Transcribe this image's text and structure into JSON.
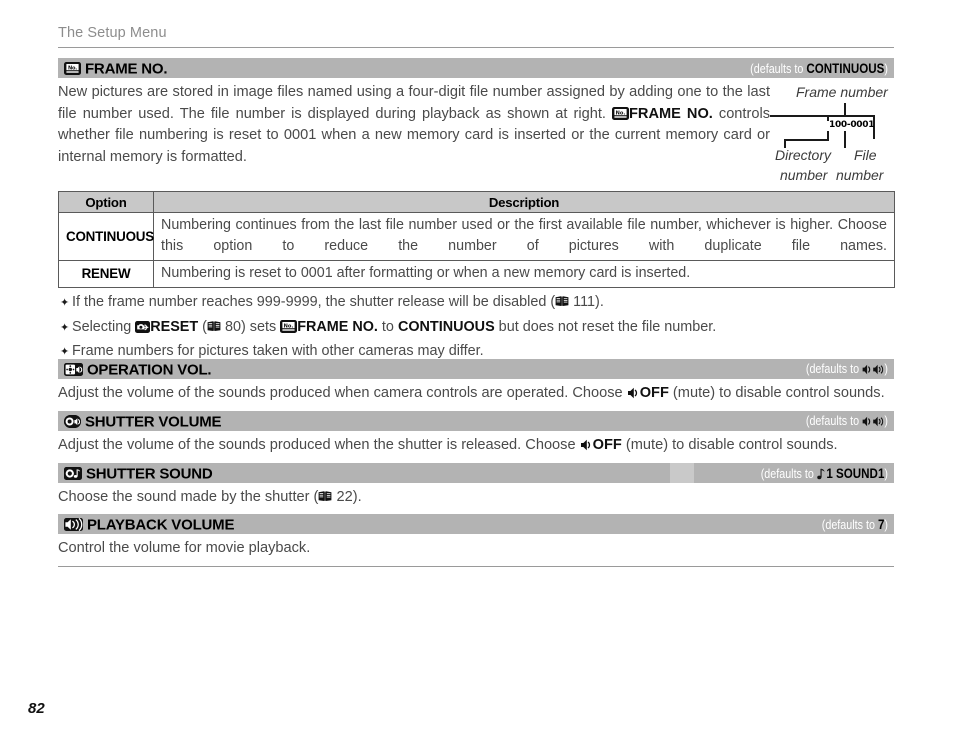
{
  "page": {
    "running_head": "The Setup Menu",
    "page_number": "82"
  },
  "sections": [
    {
      "id": "frame-no",
      "icon": "frame-no-icon",
      "title": "FRAME NO.",
      "defaults_prefix": "(defaults to ",
      "defaults_value": "CONTINUOUS",
      "defaults_suffix": ")",
      "body_part1": "New pictures are stored in image files named using a four-digit file number assigned by adding one to the last file number used.  The file number is displayed during playback as shown at right.  ",
      "body_keyword": "FRAME NO.",
      "body_part2": " controls whether file numbering is reset to 0001 when a new memory card is inserted or the current memory card or internal memory is formatted."
    },
    {
      "id": "operation-vol",
      "icon": "operation-volume-icon",
      "title": "OPERATION VOL.",
      "defaults_prefix": "(defaults to ",
      "defaults_value": "speaker-medium-icon",
      "defaults_suffix": ")",
      "body_part1": "Adjust the volume of the sounds produced when camera controls are operated.  Choose ",
      "body_keyword": "OFF",
      "body_part2": " (mute) to disable control sounds."
    },
    {
      "id": "shutter-volume",
      "icon": "shutter-volume-icon",
      "title": "SHUTTER VOLUME",
      "defaults_prefix": "(defaults to ",
      "defaults_value": "speaker-medium-icon",
      "defaults_suffix": ")",
      "body_part1": "Adjust the volume of the sounds produced when the shutter is released.  Choose ",
      "body_keyword": "OFF",
      "body_part2": " (mute) to disable control sounds."
    },
    {
      "id": "shutter-sound",
      "icon": "shutter-sound-icon",
      "title": "SHUTTER SOUND",
      "defaults_prefix": "(defaults to ",
      "defaults_value": "1 SOUND1",
      "defaults_note": "note-icon",
      "defaults_suffix": ")",
      "body_part1": "Choose the sound made by the shutter (",
      "body_ref": "22",
      "body_part2": ")."
    },
    {
      "id": "playback-volume",
      "icon": "playback-volume-icon",
      "title": "PLAYBACK VOLUME",
      "defaults_prefix": "(defaults to ",
      "defaults_value": "7",
      "defaults_suffix": ")",
      "body_part1": "Control the volume for movie playback."
    }
  ],
  "diagram": {
    "top_label": "Frame number",
    "value": "100-0001",
    "left_label_line1": "Directory",
    "left_label_line2": "number",
    "right_label_line1": "File",
    "right_label_line2": "number"
  },
  "table": {
    "headers": [
      "Option",
      "Description"
    ],
    "rows": [
      {
        "option": "CONTINUOUS",
        "description": "Numbering continues from the last file number used or the first available file number, whichever is higher.  Choose this option to reduce the number of pictures with duplicate file names."
      },
      {
        "option": "RENEW",
        "description": "Numbering is reset to 0001 after formatting or when a new memory card is inserted."
      }
    ]
  },
  "notes": {
    "bullet1_a": "If the frame number reaches 999-9999, the shutter release will be disabled (",
    "bullet1_ref": "111",
    "bullet1_b": ").",
    "bullet2_a": "Selecting ",
    "bullet2_reset": "RESET",
    "bullet2_b": " (",
    "bullet2_ref": "80",
    "bullet2_c": ") sets ",
    "bullet2_frameno": "FRAME NO.",
    "bullet2_d": " to ",
    "bullet2_continuous": "CONTINUOUS",
    "bullet2_e": " but does not reset the file number.",
    "bullet3": "Frame numbers for pictures taken with other cameras may differ."
  },
  "colors": {
    "bar": "#b3b3b3",
    "bar_light": "#c9c9c9",
    "table_header": "#c8c8c8",
    "text": "#4a4a4a",
    "muted": "#8d8d8d"
  }
}
